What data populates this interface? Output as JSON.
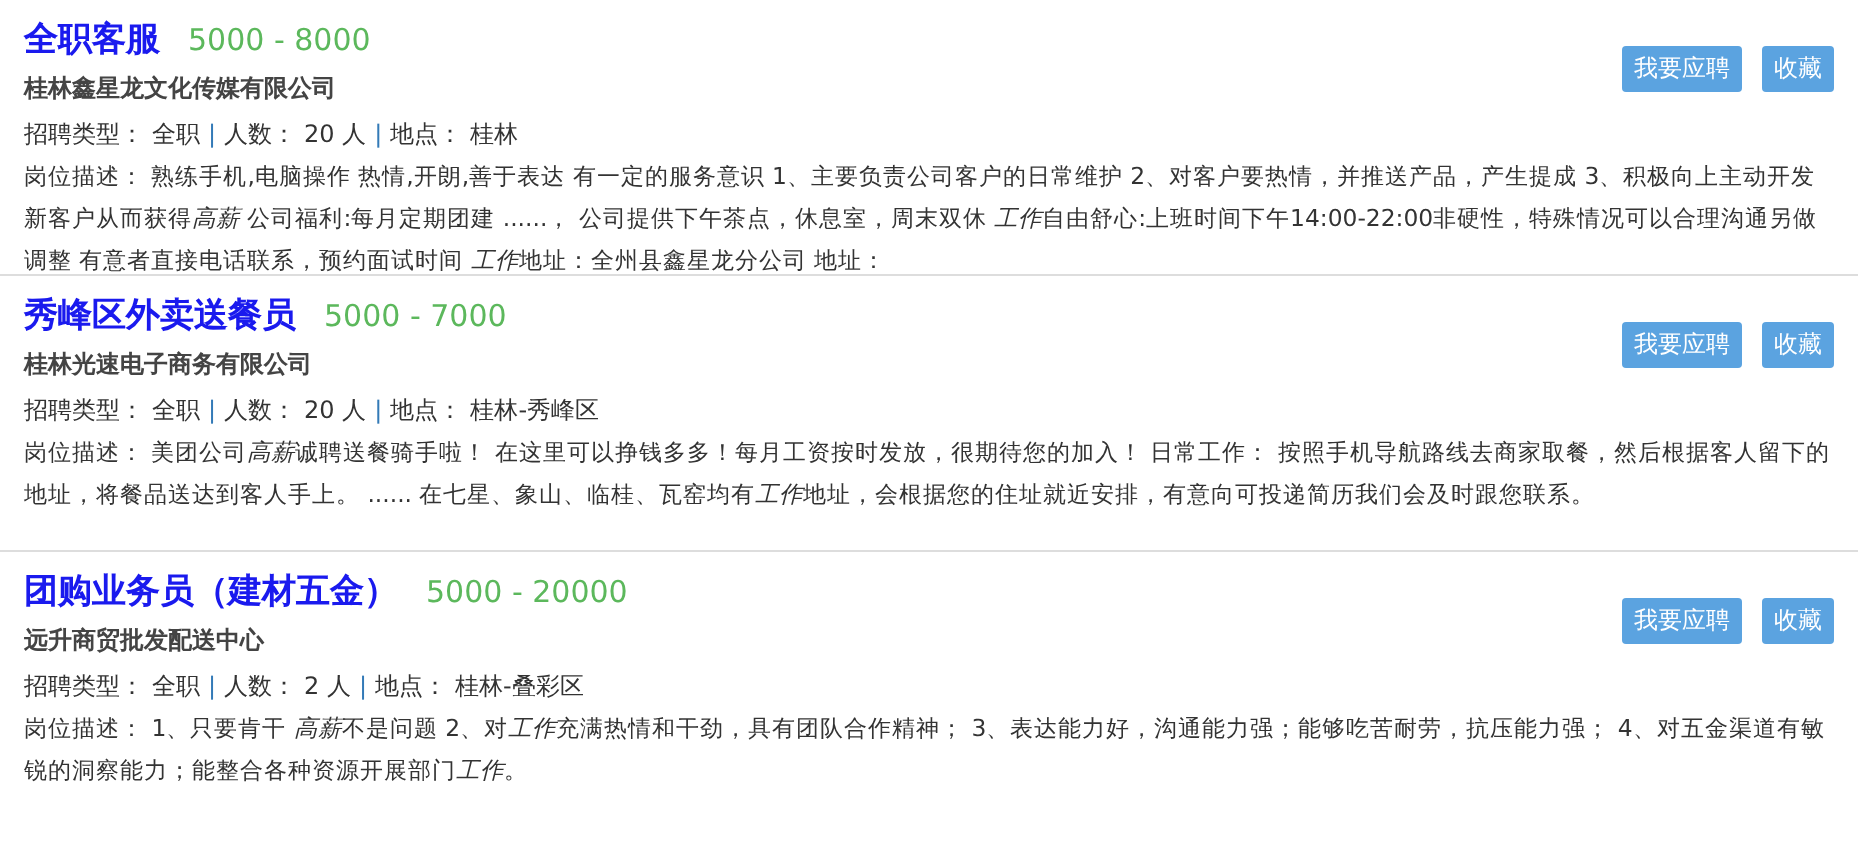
{
  "jobs": [
    {
      "title": "全职客服",
      "salary": "5000 - 8000",
      "company": "桂林鑫星龙文化传媒有限公司",
      "type_label": "招聘类型：",
      "type": "全职",
      "separator": "|",
      "count_label": "人数：",
      "count": "20 人",
      "separator_2": "|",
      "place_label": "地点：",
      "place": "桂林",
      "description": [
        {
          "text": "岗位描述： 熟练手机,电脑操作 热情,开朗,善于表达 有一定的服务意识 1、主要负责公司客户的日常维护 2、对客户要热情，并推送产品，产生提成 3、积极向上主动开发新客户从而获得",
          "italic": false
        },
        {
          "text": "高薪",
          "italic": true
        },
        {
          "text": " 公司福利:每月定期团建 ......， 公司提供下午茶点，休息室，周末双休 ",
          "italic": false
        },
        {
          "text": "工作",
          "italic": true
        },
        {
          "text": "自由舒心:上班时间下午14:00-22:00非硬性，特殊情况可以合理沟通另做调整 有意者直接电话联系，预约面试时间 ",
          "italic": false
        },
        {
          "text": "工作",
          "italic": true
        },
        {
          "text": "地址：全州县鑫星龙分公司 地址：",
          "italic": false
        }
      ],
      "buttons": [
        "我要应聘",
        "收藏"
      ]
    },
    {
      "title": "秀峰区外卖送餐员",
      "salary": "5000 - 7000",
      "company": "桂林光速电子商务有限公司",
      "type_label": "招聘类型：",
      "type": "全职",
      "separator": "|",
      "count_label": "人数：",
      "count": "20 人",
      "separator_2": "|",
      "place_label": "地点：",
      "place": "桂林-秀峰区",
      "description": [
        {
          "text": "岗位描述： 美团公司",
          "italic": false
        },
        {
          "text": "高薪",
          "italic": true
        },
        {
          "text": "诚聘送餐骑手啦！ 在这里可以挣钱多多！每月工资按时发放，很期待您的加入！ 日常工作： 按照手机导航路线去商家取餐，然后根据客人留下的地址，将餐品送达到客人手上。 ...... 在七星、象山、临桂、瓦窑均有",
          "italic": false
        },
        {
          "text": "工作",
          "italic": true
        },
        {
          "text": "地址，会根据您的住址就近安排，有意向可投递简历我们会及时跟您联系。",
          "italic": false
        }
      ],
      "buttons": [
        "我要应聘",
        "收藏"
      ]
    },
    {
      "title": "团购业务员（建材五金）",
      "salary": "5000 - 20000",
      "company": "远升商贸批发配送中心",
      "type_label": "招聘类型：",
      "type": "全职",
      "separator": "|",
      "count_label": "人数：",
      "count": "2 人",
      "separator_2": "|",
      "place_label": "地点：",
      "place": "桂林-叠彩区",
      "description": [
        {
          "text": "岗位描述： 1、只要肯干 ",
          "italic": false
        },
        {
          "text": "高薪",
          "italic": true
        },
        {
          "text": "不是问题 2、对",
          "italic": false
        },
        {
          "text": "工作",
          "italic": true
        },
        {
          "text": "充满热情和干劲，具有团队合作精神； 3、表达能力好，沟通能力强；能够吃苦耐劳，抗压能力强； 4、对五金渠道有敏锐的洞察能力；能整合各种资源开展部门",
          "italic": false
        },
        {
          "text": "工作",
          "italic": true
        },
        {
          "text": "。",
          "italic": false
        }
      ],
      "buttons": [
        "我要应聘",
        "收藏"
      ]
    }
  ]
}
